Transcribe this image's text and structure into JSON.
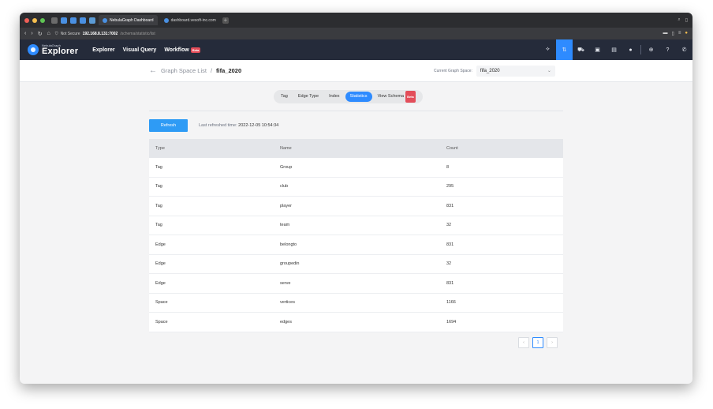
{
  "browser": {
    "tabs": [
      {
        "label": "NebulaGraph Dashboard",
        "active": true
      },
      {
        "label": "dashboard.vesoft-inc.com",
        "active": false
      }
    ],
    "url": {
      "security": "Not Secure",
      "host": "192.168.8.131:7002",
      "path": "/schema/statistic/list"
    }
  },
  "app": {
    "logo_small": "NebulaGraph",
    "logo_big": "Explorer",
    "nav": [
      {
        "label": "Explorer"
      },
      {
        "label": "Visual Query"
      },
      {
        "label": "Workflow",
        "badge": "Beta"
      }
    ]
  },
  "breadcrumb": {
    "link": "Graph Space List",
    "separator": "/",
    "current": "fifa_2020"
  },
  "space_selector": {
    "label": "Current Graph Space:",
    "value": "fifa_2020"
  },
  "schema_tabs": [
    {
      "label": "Tag",
      "active": false
    },
    {
      "label": "Edge Type",
      "active": false
    },
    {
      "label": "Index",
      "active": false
    },
    {
      "label": "Statistics",
      "active": true
    },
    {
      "label": "View Schema",
      "badge": "Beta",
      "active": false
    }
  ],
  "refresh": {
    "button_label": "Refresh",
    "last_label": "Last refreshed time:",
    "last_time": "2022-12-05 10:54:34"
  },
  "table": {
    "columns": [
      "Type",
      "Name",
      "Count"
    ],
    "rows": [
      [
        "Tag",
        "Group",
        "8"
      ],
      [
        "Tag",
        "club",
        "295"
      ],
      [
        "Tag",
        "player",
        "831"
      ],
      [
        "Tag",
        "team",
        "32"
      ],
      [
        "Edge",
        "belongto",
        "831"
      ],
      [
        "Edge",
        "groupedin",
        "32"
      ],
      [
        "Edge",
        "serve",
        "831"
      ],
      [
        "Space",
        "vertices",
        "1166"
      ],
      [
        "Space",
        "edges",
        "1694"
      ]
    ]
  },
  "pagination": {
    "prev": "‹",
    "current": "1",
    "next": "›"
  }
}
